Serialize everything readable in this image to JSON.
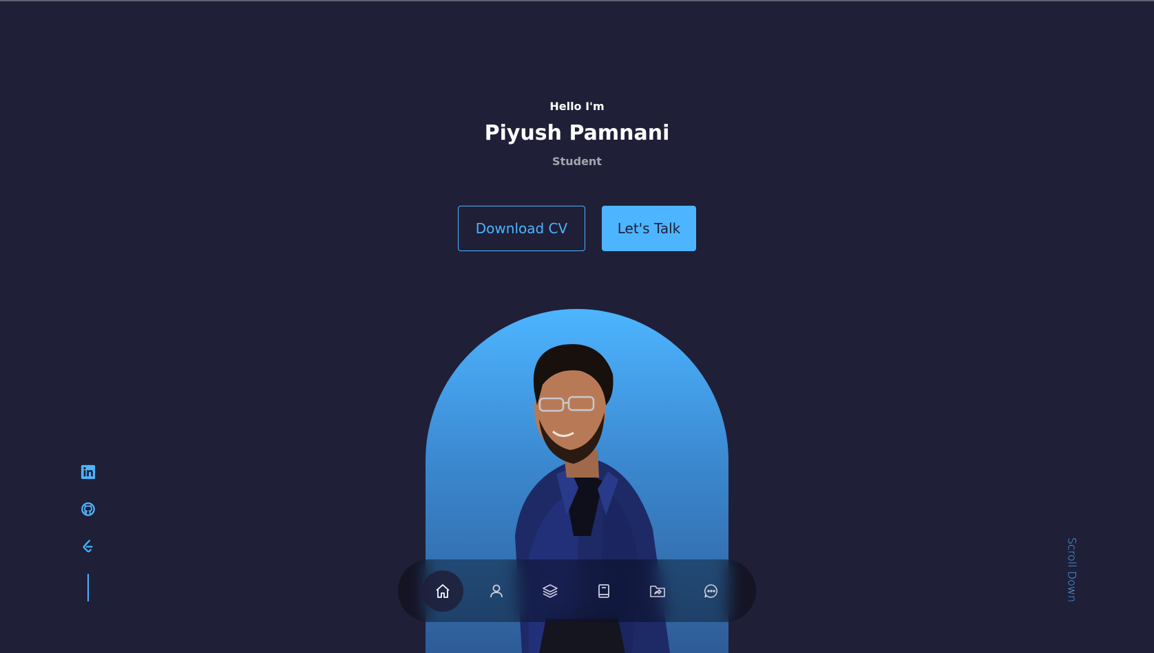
{
  "hero": {
    "greeting": "Hello I'm",
    "name": "Piyush Pamnani",
    "role": "Student"
  },
  "cta": {
    "download_label": "Download CV",
    "talk_label": "Let's Talk"
  },
  "socials": [
    {
      "icon": "linkedin-icon"
    },
    {
      "icon": "github-icon"
    },
    {
      "icon": "leetcode-icon"
    }
  ],
  "scroll": {
    "label": "Scroll Down"
  },
  "nav": {
    "items": [
      {
        "icon": "home-icon",
        "active": true
      },
      {
        "icon": "user-icon",
        "active": false
      },
      {
        "icon": "layers-icon",
        "active": false
      },
      {
        "icon": "book-icon",
        "active": false
      },
      {
        "icon": "folder-share-icon",
        "active": false
      },
      {
        "icon": "chat-icon",
        "active": false
      }
    ]
  },
  "colors": {
    "background": "#1f1f38",
    "accent": "#4db5ff",
    "text": "#ffffff",
    "muted": "rgba(255,255,255,0.6)"
  }
}
